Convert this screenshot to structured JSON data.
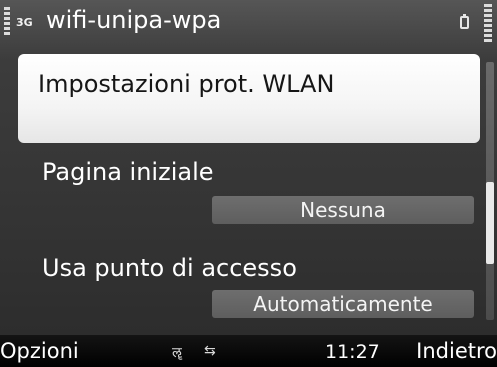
{
  "status_bar": {
    "network_type": "3G",
    "title": "wifi-unipa-wpa",
    "signal_icon": "signal-strength-icon",
    "battery_icon": "battery-icon"
  },
  "settings_list": {
    "items": [
      {
        "label": "Impostazioni prot. WLAN",
        "selected": true
      },
      {
        "label": "Pagina iniziale",
        "value": "Nessuna"
      },
      {
        "label": "Usa punto di accesso",
        "value": "Automaticamente"
      }
    ]
  },
  "scrollbar": {
    "position_fraction": 0.68
  },
  "softkeys": {
    "left": "Opzioni",
    "right": "Indietro",
    "clock": "11:27",
    "indicator_icons": [
      "alarm-icon",
      "sync-icon"
    ]
  },
  "colors": {
    "highlight": "#f4f4f4",
    "background": "#353535",
    "value_box": "#666666"
  }
}
